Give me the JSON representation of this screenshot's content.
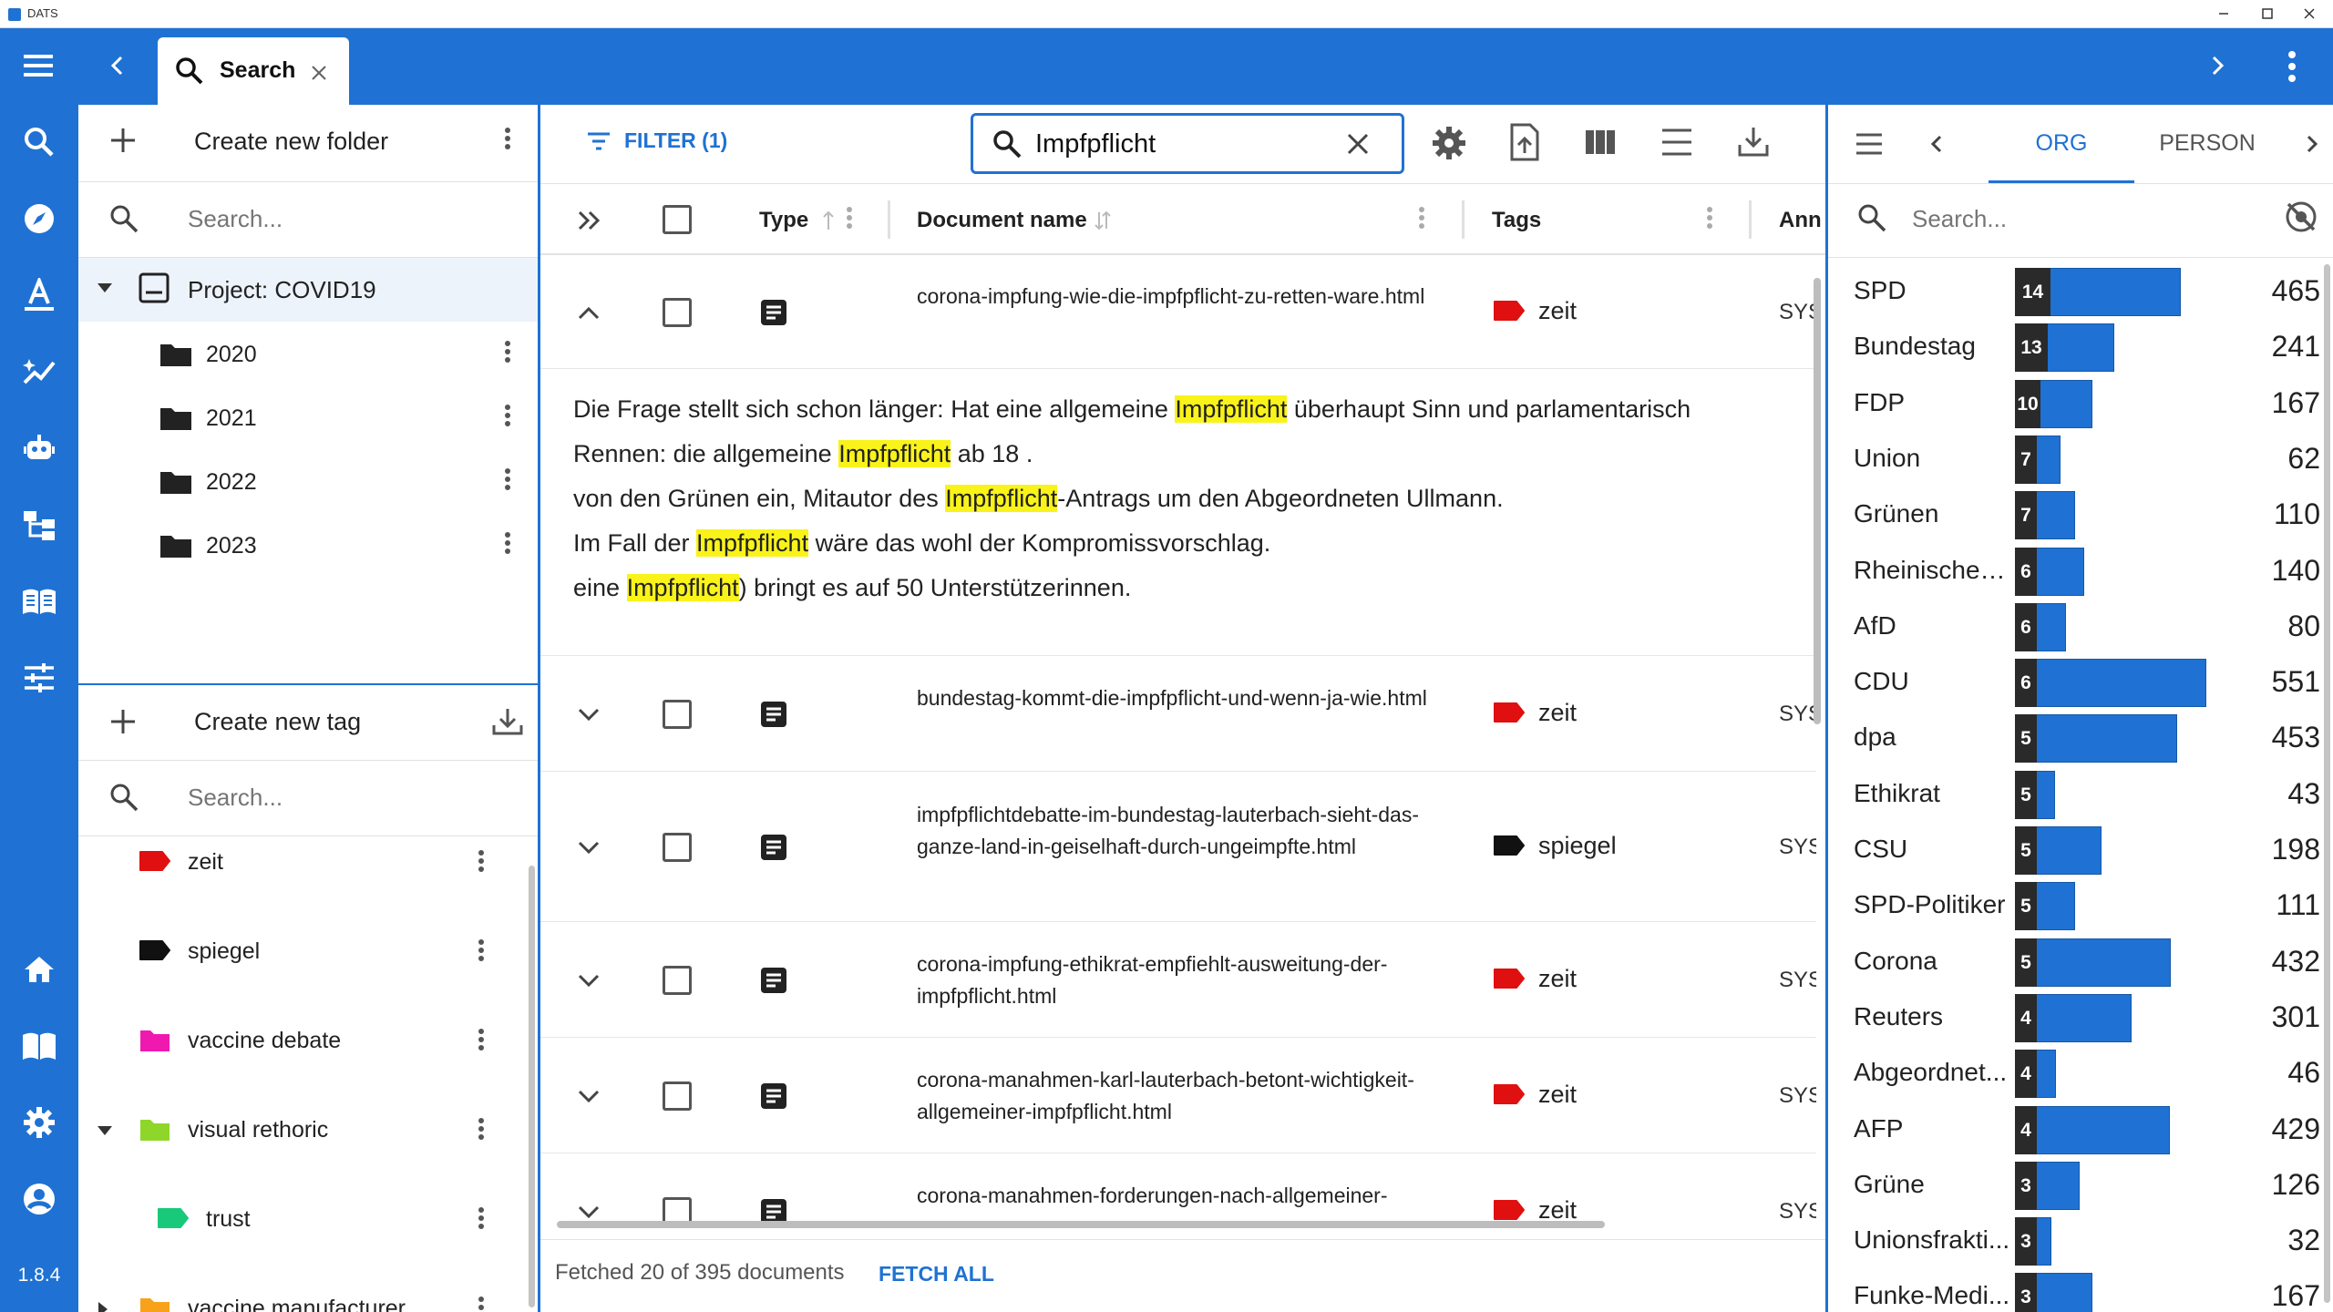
{
  "window": {
    "title": "DATS"
  },
  "appbar": {
    "tab_label": "Search"
  },
  "rail": {
    "version": "1.8.4"
  },
  "folders": {
    "create_label": "Create new folder",
    "search_placeholder": "Search...",
    "project": "Project: COVID19",
    "items": [
      {
        "label": "2020"
      },
      {
        "label": "2021"
      },
      {
        "label": "2022"
      },
      {
        "label": "2023"
      }
    ]
  },
  "tags": {
    "create_label": "Create new tag",
    "search_placeholder": "Search...",
    "items": [
      {
        "label": "zeit",
        "color": "#e01010",
        "indent": 0,
        "expander": "",
        "shape": "tag"
      },
      {
        "label": "spiegel",
        "color": "#111111",
        "indent": 0,
        "expander": "",
        "shape": "tag"
      },
      {
        "label": "vaccine debate",
        "color": "#f019b0",
        "indent": 0,
        "expander": "",
        "shape": "folder"
      },
      {
        "label": "visual rethoric",
        "color": "#8fd62a",
        "indent": 0,
        "expander": "down",
        "shape": "folder"
      },
      {
        "label": "trust",
        "color": "#19c97a",
        "indent": 1,
        "expander": "",
        "shape": "tag"
      },
      {
        "label": "vaccine manufacturer",
        "color": "#f7a21a",
        "indent": 0,
        "expander": "right",
        "shape": "folder"
      }
    ]
  },
  "toolbar": {
    "filter_label": "FILTER (1)",
    "search_value": "Impfpflicht"
  },
  "table": {
    "headers": {
      "type": "Type",
      "name": "Document name",
      "tags": "Tags",
      "annotations": "Ann"
    },
    "rows": [
      {
        "name": "corona-impfung-wie-die-impfpflicht-zu-retten-ware.html",
        "tag": "zeit",
        "tag_color": "#e01010",
        "sys": "SYS",
        "expanded": true
      },
      {
        "name": "bundestag-kommt-die-impfpflicht-und-wenn-ja-wie.html",
        "tag": "zeit",
        "tag_color": "#e01010",
        "sys": "SYS",
        "expanded": false
      },
      {
        "name": "impfpflichtdebatte-im-bundestag-lauterbach-sieht-das-ganze-land-in-geiselhaft-durch-ungeimpfte.html",
        "tag": "spiegel",
        "tag_color": "#111111",
        "sys": "SYS",
        "expanded": false
      },
      {
        "name": "corona-impfung-ethikrat-empfiehlt-ausweitung-der-impfpflicht.html",
        "tag": "zeit",
        "tag_color": "#e01010",
        "sys": "SYS",
        "expanded": false
      },
      {
        "name": "corona-manahmen-karl-lauterbach-betont-wichtigkeit-allgemeiner-impfpflicht.html",
        "tag": "zeit",
        "tag_color": "#e01010",
        "sys": "SYS",
        "expanded": false
      },
      {
        "name": "corona-manahmen-forderungen-nach-allgemeiner-",
        "tag": "zeit",
        "tag_color": "#e01010",
        "sys": "SYS",
        "expanded": false
      }
    ],
    "snippet": [
      {
        "before": "Die Frage stellt sich schon länger: Hat eine allgemeine ",
        "hit": "Impfpflicht",
        "after": " überhaupt Sinn und parlamentarisch"
      },
      {
        "before": "Rennen: die allgemeine ",
        "hit": "Impfpflicht",
        "after": " ab 18 ."
      },
      {
        "before": "von den Grünen ein, Mitautor des ",
        "hit": "Impfpflicht",
        "after": "-Antrags um den Abgeordneten Ullmann."
      },
      {
        "before": "Im Fall der ",
        "hit": "Impfpflicht",
        "after": " wäre das wohl der Kompromissvorschlag."
      },
      {
        "before": "eine ",
        "hit": "Impfpflicht",
        "after": ") bringt es auf 50 Unterstützerinnen."
      }
    ],
    "footer": {
      "status": "Fetched 20 of 395 documents",
      "fetch_all": "FETCH ALL"
    }
  },
  "entities": {
    "tabs": [
      "ORG",
      "PERSON"
    ],
    "active_tab": "ORG",
    "search_placeholder": "Search...",
    "max_total": 551,
    "items": [
      {
        "name": "SPD",
        "count": 14,
        "total": 465
      },
      {
        "name": "Bundestag",
        "count": 13,
        "total": 241
      },
      {
        "name": "FDP",
        "count": 10,
        "total": 167
      },
      {
        "name": "Union",
        "count": 7,
        "total": 62
      },
      {
        "name": "Grünen",
        "count": 7,
        "total": 110
      },
      {
        "name": "Rheinischen...",
        "count": 6,
        "total": 140
      },
      {
        "name": "AfD",
        "count": 6,
        "total": 80
      },
      {
        "name": "CDU",
        "count": 6,
        "total": 551
      },
      {
        "name": "dpa",
        "count": 5,
        "total": 453
      },
      {
        "name": "Ethikrat",
        "count": 5,
        "total": 43
      },
      {
        "name": "CSU",
        "count": 5,
        "total": 198
      },
      {
        "name": "SPD-Politiker",
        "count": 5,
        "total": 111
      },
      {
        "name": "Corona",
        "count": 5,
        "total": 432
      },
      {
        "name": "Reuters",
        "count": 4,
        "total": 301
      },
      {
        "name": "Abgeordnet...",
        "count": 4,
        "total": 46
      },
      {
        "name": "AFP",
        "count": 4,
        "total": 429
      },
      {
        "name": "Grüne",
        "count": 3,
        "total": 126
      },
      {
        "name": "Unionsfrakti...",
        "count": 3,
        "total": 32
      },
      {
        "name": "Funke-Medi...",
        "count": 3,
        "total": 167
      }
    ]
  }
}
